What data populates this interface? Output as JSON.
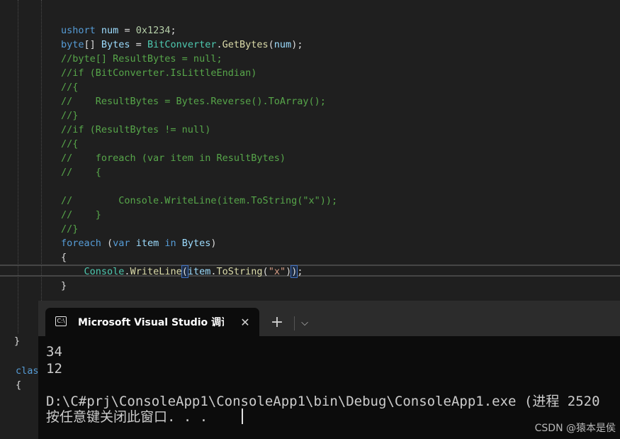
{
  "editor": {
    "lines": [
      [
        {
          "c": "kw",
          "t": "ushort"
        },
        {
          "c": "pl",
          "t": " "
        },
        {
          "c": "id",
          "t": "num"
        },
        {
          "c": "pl",
          "t": " = "
        },
        {
          "c": "nm",
          "t": "0x1234"
        },
        {
          "c": "pl",
          "t": ";"
        }
      ],
      [
        {
          "c": "kw",
          "t": "byte"
        },
        {
          "c": "pl",
          "t": "[] "
        },
        {
          "c": "id",
          "t": "Bytes"
        },
        {
          "c": "pl",
          "t": " = "
        },
        {
          "c": "ty",
          "t": "BitConverter"
        },
        {
          "c": "pl",
          "t": "."
        },
        {
          "c": "mt",
          "t": "GetBytes"
        },
        {
          "c": "pl",
          "t": "("
        },
        {
          "c": "id",
          "t": "num"
        },
        {
          "c": "pl",
          "t": ");"
        }
      ],
      [
        {
          "c": "cm",
          "t": "//byte[] ResultBytes = null;"
        }
      ],
      [
        {
          "c": "cm",
          "t": "//if (BitConverter.IsLittleEndian)"
        }
      ],
      [
        {
          "c": "cm",
          "t": "//{"
        }
      ],
      [
        {
          "c": "cm",
          "t": "//    ResultBytes = Bytes.Reverse().ToArray();"
        }
      ],
      [
        {
          "c": "cm",
          "t": "//}"
        }
      ],
      [
        {
          "c": "cm",
          "t": "//if (ResultBytes != null)"
        }
      ],
      [
        {
          "c": "cm",
          "t": "//{"
        }
      ],
      [
        {
          "c": "cm",
          "t": "//    foreach (var item in ResultBytes)"
        }
      ],
      [
        {
          "c": "cm",
          "t": "//    {"
        }
      ],
      [
        {
          "c": "pl",
          "t": ""
        }
      ],
      [
        {
          "c": "cm",
          "t": "//        Console.WriteLine(item.ToString(\"x\"));"
        }
      ],
      [
        {
          "c": "cm",
          "t": "//    }"
        }
      ],
      [
        {
          "c": "cm",
          "t": "//}"
        }
      ],
      [
        {
          "c": "kw",
          "t": "foreach"
        },
        {
          "c": "pl",
          "t": " ("
        },
        {
          "c": "kw",
          "t": "var"
        },
        {
          "c": "pl",
          "t": " "
        },
        {
          "c": "id",
          "t": "item"
        },
        {
          "c": "pl",
          "t": " "
        },
        {
          "c": "kw",
          "t": "in"
        },
        {
          "c": "pl",
          "t": " "
        },
        {
          "c": "id",
          "t": "Bytes"
        },
        {
          "c": "pl",
          "t": ")"
        }
      ],
      [
        {
          "c": "pl",
          "t": "{"
        }
      ],
      [
        {
          "c": "pl",
          "t": "    "
        },
        {
          "c": "ty",
          "t": "Console"
        },
        {
          "c": "pl",
          "t": "."
        },
        {
          "c": "mt",
          "t": "WriteLine"
        },
        {
          "c": "hl",
          "t": "("
        },
        {
          "c": "id",
          "t": "item"
        },
        {
          "c": "pl",
          "t": "."
        },
        {
          "c": "mt",
          "t": "ToString"
        },
        {
          "c": "pl",
          "t": "("
        },
        {
          "c": "st",
          "t": "\"x\""
        },
        {
          "c": "pl",
          "t": ")"
        },
        {
          "c": "hl",
          "t": ")"
        },
        {
          "c": "pl",
          "t": ";"
        }
      ],
      [
        {
          "c": "pl",
          "t": "}"
        }
      ]
    ],
    "left_margin": {
      "closing_brace": "}",
      "class_keyword": "clas",
      "open_brace": "{"
    }
  },
  "terminal": {
    "tab_icon": "C:\\",
    "tab_title": "Microsoft Visual Studio 调试控",
    "close_glyph": "✕",
    "new_tab_glyph": "+",
    "dropdown_glyph": "⌵",
    "output_lines": [
      "34",
      "12",
      "",
      "D:\\C#prj\\ConsoleApp1\\ConsoleApp1\\bin\\Debug\\ConsoleApp1.exe (进程 2520",
      "按任意键关闭此窗口. . ."
    ]
  },
  "watermark": "CSDN @猿本是侯"
}
